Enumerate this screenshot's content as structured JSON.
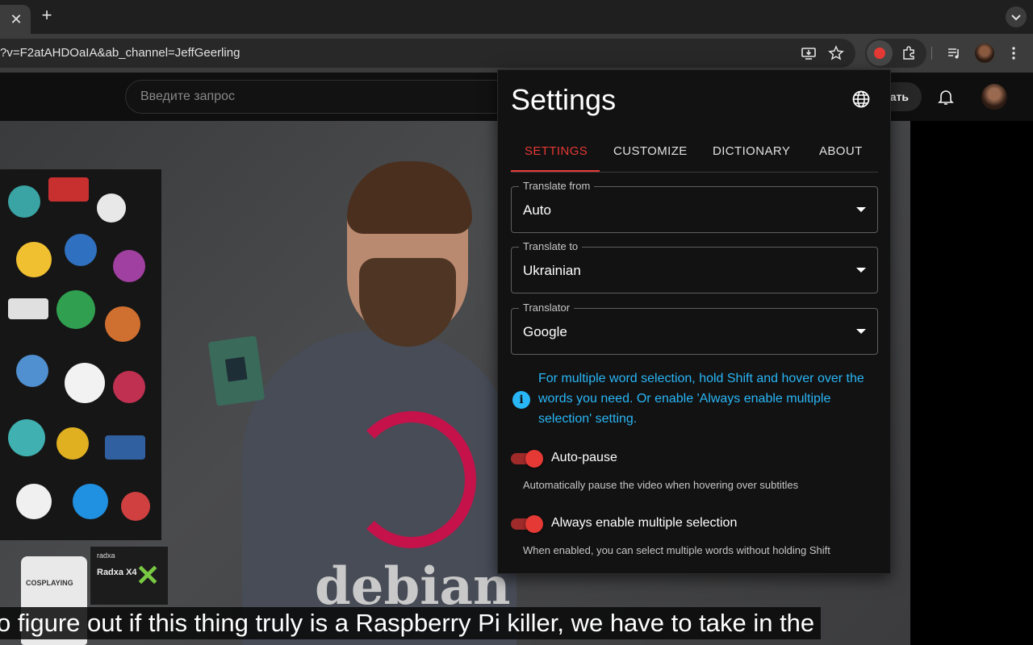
{
  "browser": {
    "tab_close_glyph": "✕",
    "new_tab_glyph": "+",
    "url": "?v=F2atAHDOaIA&ab_channel=JeffGeerling"
  },
  "youtube": {
    "search_placeholder": "Введите запрос",
    "create_button_label": "ать"
  },
  "video": {
    "mug_text": "COSPLAYING",
    "radxa_logo": "radxa",
    "radxa_name": "Radxa X4",
    "shirt_text": "debian",
    "subtitle": "o figure out if this thing truly is a Raspberry Pi killer, we have to take in the"
  },
  "popup": {
    "title": "Settings",
    "tabs": [
      {
        "label": "SETTINGS",
        "active": true
      },
      {
        "label": "CUSTOMIZE",
        "active": false
      },
      {
        "label": "DICTIONARY",
        "active": false
      },
      {
        "label": "ABOUT",
        "active": false
      }
    ],
    "selects": [
      {
        "label": "Translate from",
        "value": "Auto"
      },
      {
        "label": "Translate to",
        "value": "Ukrainian"
      },
      {
        "label": "Translator",
        "value": "Google"
      }
    ],
    "info_icon_glyph": "i",
    "info_text": "For multiple word selection, hold Shift and hover over the words you need. Or enable 'Always enable multiple selection' setting.",
    "toggles": [
      {
        "label": "Auto-pause",
        "description": "Automatically pause the video when hovering over subtitles",
        "on": true
      },
      {
        "label": "Always enable multiple selection",
        "description": "When enabled, you can select multiple words without holding Shift",
        "on": true
      }
    ]
  },
  "colors": {
    "accent": "#e53935",
    "info": "#29b6f6",
    "popup_bg": "#121212"
  },
  "icons": [
    "close-icon",
    "plus-icon",
    "chevron-down-icon",
    "install-icon",
    "star-icon",
    "extension-icon",
    "puzzle-icon",
    "media-icon",
    "more-vert-icon",
    "bell-icon",
    "globe-icon",
    "info-icon",
    "caret-down-icon"
  ]
}
